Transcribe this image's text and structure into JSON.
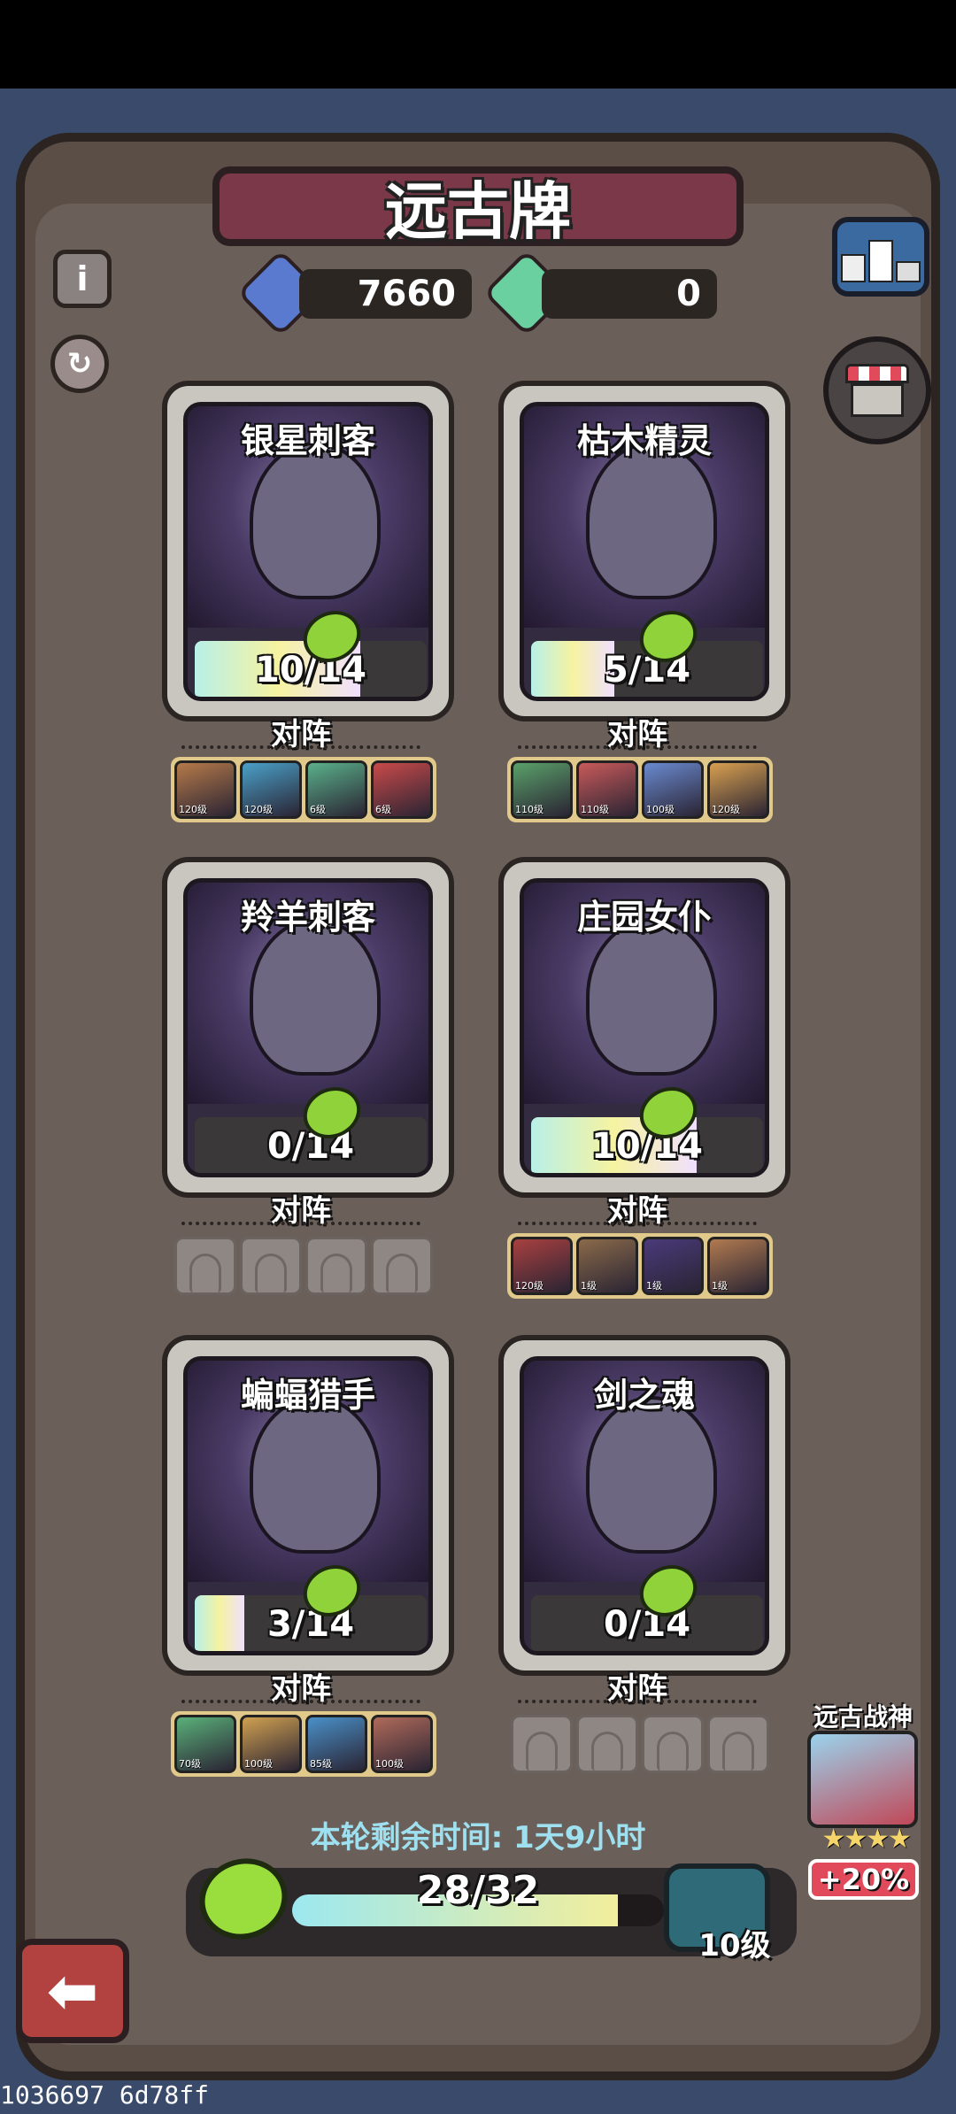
{
  "title": "远古牌",
  "currency": {
    "blue_gem": "7660",
    "green_gem": "0"
  },
  "cards": [
    {
      "name": "银星刺客",
      "progress": "10/14",
      "current": 10,
      "max": 14,
      "lineup_label": "对阵",
      "lineup": [
        {
          "lvl": "120级",
          "color": "#b57a4a"
        },
        {
          "lvl": "120级",
          "color": "#4aa0c8"
        },
        {
          "lvl": "6级",
          "color": "#5ab08a"
        },
        {
          "lvl": "6级",
          "color": "#c84a4a"
        }
      ]
    },
    {
      "name": "枯木精灵",
      "progress": "5/14",
      "current": 5,
      "max": 14,
      "lineup_label": "对阵",
      "lineup": [
        {
          "lvl": "110级",
          "color": "#5aa06a"
        },
        {
          "lvl": "110级",
          "color": "#c85a5a"
        },
        {
          "lvl": "100级",
          "color": "#6a8ad0"
        },
        {
          "lvl": "120级",
          "color": "#d8a050"
        }
      ]
    },
    {
      "name": "羚羊刺客",
      "progress": "0/14",
      "current": 0,
      "max": 14,
      "lineup_label": "对阵",
      "lineup": []
    },
    {
      "name": "庄园女仆",
      "progress": "10/14",
      "current": 10,
      "max": 14,
      "lineup_label": "对阵",
      "lineup": [
        {
          "lvl": "120级",
          "color": "#a84040"
        },
        {
          "lvl": "1级",
          "color": "#8a6a4a"
        },
        {
          "lvl": "1级",
          "color": "#4a3a7a"
        },
        {
          "lvl": "1级",
          "color": "#b07a50"
        }
      ]
    },
    {
      "name": "蝙蝠猎手",
      "progress": "3/14",
      "current": 3,
      "max": 14,
      "lineup_label": "对阵",
      "lineup": [
        {
          "lvl": "70级",
          "color": "#5ab07a"
        },
        {
          "lvl": "100级",
          "color": "#d0a050"
        },
        {
          "lvl": "85级",
          "color": "#4a90c8"
        },
        {
          "lvl": "100级",
          "color": "#b06a5a"
        }
      ]
    },
    {
      "name": "剑之魂",
      "progress": "0/14",
      "current": 0,
      "max": 14,
      "lineup_label": "对阵",
      "lineup": []
    }
  ],
  "timer_text": "本轮剩余时间: 1天9小时",
  "overall_progress": {
    "text": "28/32",
    "current": 28,
    "max": 32
  },
  "chest_level": "10级",
  "ancient_god": {
    "label": "远古战神",
    "stars": "★★★★",
    "bonus": "+20%"
  },
  "footer_id": "1036697 6d78ff",
  "icons": {
    "info": "info-icon",
    "refresh": "refresh-icon",
    "ranking": "ranking-podium-icon",
    "shop": "shop-icon",
    "back": "back-arrow-icon"
  },
  "colors": {
    "title_bar": "#7a3848",
    "blue_gem": "#5a7ad0",
    "green_gem": "#6ad0a0",
    "back_button": "#b2423f"
  }
}
